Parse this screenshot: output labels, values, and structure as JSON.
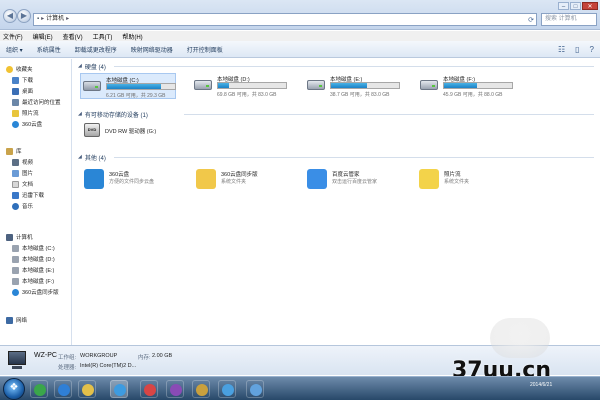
{
  "address": {
    "root": "计算机",
    "search_placeholder": "搜索 计算机"
  },
  "menu": [
    "文件(F)",
    "编辑(E)",
    "查看(V)",
    "工具(T)",
    "帮助(H)"
  ],
  "toolbar": [
    "组织 ▾",
    "系统属性",
    "卸载或更改程序",
    "映射网络驱动器",
    "打开控制面板"
  ],
  "nav": {
    "favorites": "收藏夹",
    "fav_items": [
      "下载",
      "桌面",
      "最近访问的位置",
      "照片流",
      "360云盘"
    ],
    "libraries": "库",
    "lib_items": [
      "视频",
      "图片",
      "文档",
      "迅雷下载",
      "音乐"
    ],
    "computer": "计算机",
    "comp_items": [
      "本地磁盘 (C:)",
      "本地磁盘 (D:)",
      "本地磁盘 (E:)",
      "本地磁盘 (F:)",
      "360云盘同步版"
    ],
    "network": "网络"
  },
  "groups": {
    "hdd": "硬盘 (4)",
    "removable": "有可移动存储的设备 (1)",
    "other": "其他 (4)"
  },
  "drives": [
    {
      "name": "本地磁盘 (C:)",
      "info": "6.21 GB 可用，共 29.3 GB",
      "used_fraction": 0.79,
      "system": true
    },
    {
      "name": "本地磁盘 (D:)",
      "info": "69.8 GB 可用，共 83.0 GB",
      "used_fraction": 0.16,
      "system": false
    },
    {
      "name": "本地磁盘 (E:)",
      "info": "38.7 GB 可用，共 83.0 GB",
      "used_fraction": 0.53,
      "system": false
    },
    {
      "name": "本地磁盘 (F:)",
      "info": "45.9 GB 可用，共 88.0 GB",
      "used_fraction": 0.48,
      "system": false
    }
  ],
  "dvd": {
    "icon_text": "DVD",
    "label": "DVD RW 驱动器 (G:)"
  },
  "other_items": [
    {
      "name": "360云盘",
      "sub": "方便的文件同步云盘",
      "color": "#2a86d6"
    },
    {
      "name": "360云盘同步版",
      "sub": "系统文件夹",
      "color": "#f1c84a"
    },
    {
      "name": "百度云管家",
      "sub": "双击运行百度云管家",
      "color": "#3a8ee6"
    },
    {
      "name": "照片流",
      "sub": "系统文件夹",
      "color": "#f3d34a"
    }
  ],
  "details": {
    "pc_name": "WZ-PC",
    "workgroup_label": "工作组:",
    "workgroup": "WORKGROUP",
    "memory_label": "内存:",
    "memory": "2.00 GB",
    "cpu_label": "处理器:",
    "cpu": "Intel(R) Core(TM)2 D..."
  },
  "taskbar": {
    "start_glyph": "❖",
    "apps": [
      "#3aa64a",
      "#2f7fd6",
      "#e3c04a",
      "#3d9be0",
      "#d84545",
      "#8a4bb5",
      "#c9a03d",
      "#4aa0e0",
      "#62a2dd"
    ],
    "tray_text": "2014/6/21"
  },
  "watermark": "37uu.cn"
}
